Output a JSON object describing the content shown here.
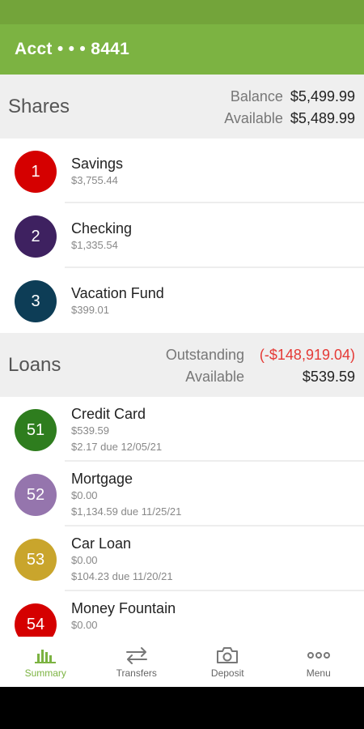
{
  "header": {
    "title": "Acct • • • 8441"
  },
  "shares": {
    "name": "Shares",
    "balance_label": "Balance",
    "balance_value": "$5,499.99",
    "available_label": "Available",
    "available_value": "$5,489.99",
    "items": [
      {
        "number": "1",
        "name": "Savings",
        "amount": "$3,755.44",
        "color": "#d50000"
      },
      {
        "number": "2",
        "name": "Checking",
        "amount": "$1,335.54",
        "color": "#3e2160"
      },
      {
        "number": "3",
        "name": "Vacation Fund",
        "amount": "$399.01",
        "color": "#0d3d56"
      }
    ]
  },
  "loans": {
    "name": "Loans",
    "outstanding_label": "Outstanding",
    "outstanding_value": "(-$148,919.04)",
    "available_label": "Available",
    "available_value": "$539.59",
    "items": [
      {
        "number": "51",
        "name": "Credit Card",
        "amount": "$539.59",
        "due": "$2.17 due 12/05/21",
        "color": "#2e7d1e"
      },
      {
        "number": "52",
        "name": "Mortgage",
        "amount": "$0.00",
        "due": "$1,134.59 due 11/25/21",
        "color": "#9575ad"
      },
      {
        "number": "53",
        "name": "Car Loan",
        "amount": "$0.00",
        "due": "$104.23 due 11/20/21",
        "color": "#c9a52c"
      },
      {
        "number": "54",
        "name": "Money Fountain",
        "amount": "$0.00",
        "due": "",
        "color": "#d50000"
      }
    ]
  },
  "nav": {
    "summary": "Summary",
    "transfers": "Transfers",
    "deposit": "Deposit",
    "menu": "Menu",
    "active_color": "#7cb342"
  }
}
